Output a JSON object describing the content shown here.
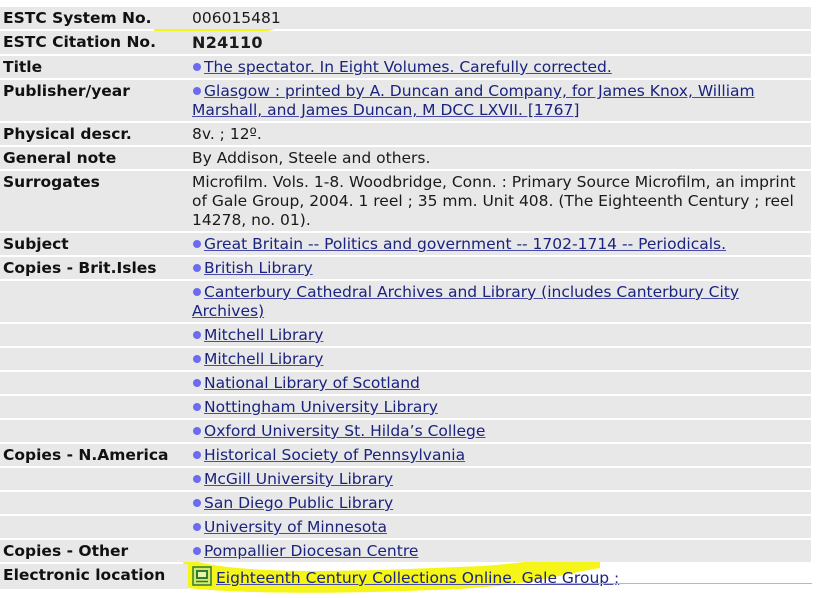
{
  "record": {
    "system_no": {
      "label": "ESTC System No.",
      "value": "006015481"
    },
    "citation_no": {
      "label": "ESTC Citation No.",
      "value": "N24110"
    },
    "title": {
      "label": "Title",
      "value": "The spectator. In Eight Volumes. Carefully corrected."
    },
    "publisher": {
      "label": "Publisher/year",
      "value": "Glasgow : printed by A. Duncan and Company, for James Knox, William Marshall, and James Duncan, M DCC LXVII. [1767]"
    },
    "physical": {
      "label": "Physical descr.",
      "value": "8v. ;  12º."
    },
    "note": {
      "label": "General note",
      "value": "By Addison, Steele and others."
    },
    "surrogates": {
      "label": "Surrogates",
      "value": "Microfilm. Vols. 1-8. Woodbridge, Conn. : Primary Source Microfilm, an imprint of Gale Group, 2004. 1 reel ; 35 mm. Unit 408. (The Eighteenth Century ; reel 14278, no. 01)."
    },
    "subject": {
      "label": "Subject",
      "value": "Great Britain -- Politics and government -- 1702-1714 -- Periodicals."
    },
    "copies_brit": {
      "label": "Copies - Brit.Isles",
      "items": [
        "British Library ",
        "Canterbury Cathedral Archives and Library (includes Canterbury City Archives) ",
        "Mitchell Library ",
        "Mitchell Library ",
        "National Library of Scotland ",
        "Nottingham University Library ",
        "Oxford University St. Hilda’s College "
      ]
    },
    "copies_na": {
      "label": "Copies - N.America",
      "items": [
        "Historical Society of Pennsylvania ",
        "McGill University Library ",
        "San Diego Public Library ",
        "University of Minnesota "
      ]
    },
    "copies_other": {
      "label": "Copies - Other",
      "items": [
        "Pompallier Diocesan Centre "
      ]
    },
    "electronic": {
      "label": "Electronic location",
      "value": "Eighteenth Century Collections Online. Gale Group ; ",
      "icon": "ecco-document-icon"
    }
  },
  "highlight_color": "#f4f400",
  "link_color": "#1a237e",
  "bullet_color": "#6b6bf0",
  "row_background": "#e8e8e8"
}
